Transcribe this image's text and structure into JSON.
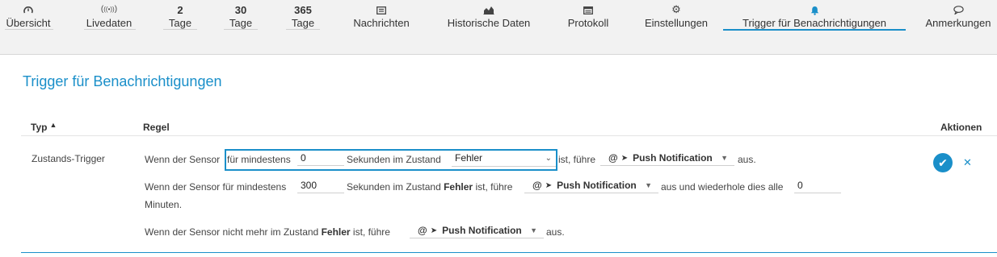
{
  "tabs": [
    {
      "icon": "gauge-icon",
      "number": "",
      "label": "Übersicht",
      "active": false
    },
    {
      "icon": "broadcast-icon",
      "number": "",
      "label": "Livedaten",
      "active": false
    },
    {
      "icon": "",
      "number": "2",
      "label": "Tage",
      "active": false
    },
    {
      "icon": "",
      "number": "30",
      "label": "Tage",
      "active": false
    },
    {
      "icon": "",
      "number": "365",
      "label": "Tage",
      "active": false
    },
    {
      "icon": "message-icon",
      "number": "",
      "label": "Nachrichten",
      "active": false
    },
    {
      "icon": "area-chart-icon",
      "number": "",
      "label": "Historische Daten",
      "active": false
    },
    {
      "icon": "log-icon",
      "number": "",
      "label": "Protokoll",
      "active": false
    },
    {
      "icon": "gear-icon",
      "number": "",
      "label": "Einstellungen",
      "active": false
    },
    {
      "icon": "bell-icon",
      "number": "",
      "label": "Trigger für Benachrichtigungen",
      "active": true
    },
    {
      "icon": "comment-icon",
      "number": "",
      "label": "Anmerkungen",
      "active": false
    }
  ],
  "page_title": "Trigger für Benachrichtigungen",
  "table": {
    "col_type": "Typ",
    "col_rule": "Regel",
    "col_actions": "Aktionen"
  },
  "row": {
    "type": "Zustands-Trigger",
    "line1": {
      "pre": "Wenn der Sensor",
      "pre2": "für mindestens",
      "seconds_value": "0",
      "mid": "Sekunden im Zustand",
      "state_value": "Fehler",
      "post": "ist, führe",
      "notification": "Push Notification",
      "end": "aus."
    },
    "line2": {
      "pre": "Wenn der Sensor für mindestens",
      "seconds_value": "300",
      "mid": "Sekunden im Zustand",
      "state": "Fehler",
      "post": "ist, führe",
      "notification": "Push Notification",
      "end": "aus und wiederhole dies alle",
      "repeat_value": "0",
      "unit": "Minuten."
    },
    "line3": {
      "pre": "Wenn der Sensor nicht mehr im Zustand",
      "state": "Fehler",
      "post": "ist, führe",
      "notification": "Push Notification",
      "end": "aus."
    }
  },
  "colors": {
    "accent": "#1a8fc9",
    "tabbar_bg": "#f2f2f2"
  }
}
